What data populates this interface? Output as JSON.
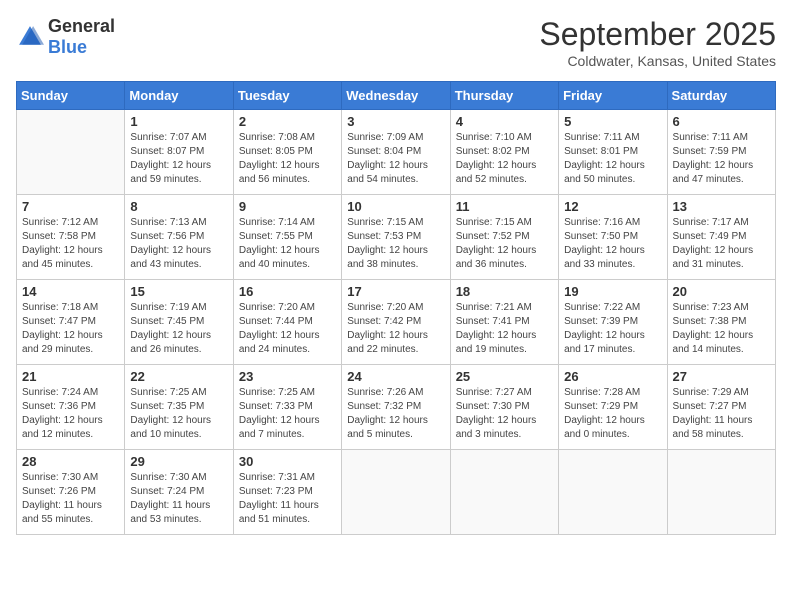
{
  "header": {
    "logo_general": "General",
    "logo_blue": "Blue",
    "month_title": "September 2025",
    "subtitle": "Coldwater, Kansas, United States"
  },
  "weekdays": [
    "Sunday",
    "Monday",
    "Tuesday",
    "Wednesday",
    "Thursday",
    "Friday",
    "Saturday"
  ],
  "weeks": [
    [
      {
        "day": "",
        "info": ""
      },
      {
        "day": "1",
        "info": "Sunrise: 7:07 AM\nSunset: 8:07 PM\nDaylight: 12 hours\nand 59 minutes."
      },
      {
        "day": "2",
        "info": "Sunrise: 7:08 AM\nSunset: 8:05 PM\nDaylight: 12 hours\nand 56 minutes."
      },
      {
        "day": "3",
        "info": "Sunrise: 7:09 AM\nSunset: 8:04 PM\nDaylight: 12 hours\nand 54 minutes."
      },
      {
        "day": "4",
        "info": "Sunrise: 7:10 AM\nSunset: 8:02 PM\nDaylight: 12 hours\nand 52 minutes."
      },
      {
        "day": "5",
        "info": "Sunrise: 7:11 AM\nSunset: 8:01 PM\nDaylight: 12 hours\nand 50 minutes."
      },
      {
        "day": "6",
        "info": "Sunrise: 7:11 AM\nSunset: 7:59 PM\nDaylight: 12 hours\nand 47 minutes."
      }
    ],
    [
      {
        "day": "7",
        "info": "Sunrise: 7:12 AM\nSunset: 7:58 PM\nDaylight: 12 hours\nand 45 minutes."
      },
      {
        "day": "8",
        "info": "Sunrise: 7:13 AM\nSunset: 7:56 PM\nDaylight: 12 hours\nand 43 minutes."
      },
      {
        "day": "9",
        "info": "Sunrise: 7:14 AM\nSunset: 7:55 PM\nDaylight: 12 hours\nand 40 minutes."
      },
      {
        "day": "10",
        "info": "Sunrise: 7:15 AM\nSunset: 7:53 PM\nDaylight: 12 hours\nand 38 minutes."
      },
      {
        "day": "11",
        "info": "Sunrise: 7:15 AM\nSunset: 7:52 PM\nDaylight: 12 hours\nand 36 minutes."
      },
      {
        "day": "12",
        "info": "Sunrise: 7:16 AM\nSunset: 7:50 PM\nDaylight: 12 hours\nand 33 minutes."
      },
      {
        "day": "13",
        "info": "Sunrise: 7:17 AM\nSunset: 7:49 PM\nDaylight: 12 hours\nand 31 minutes."
      }
    ],
    [
      {
        "day": "14",
        "info": "Sunrise: 7:18 AM\nSunset: 7:47 PM\nDaylight: 12 hours\nand 29 minutes."
      },
      {
        "day": "15",
        "info": "Sunrise: 7:19 AM\nSunset: 7:45 PM\nDaylight: 12 hours\nand 26 minutes."
      },
      {
        "day": "16",
        "info": "Sunrise: 7:20 AM\nSunset: 7:44 PM\nDaylight: 12 hours\nand 24 minutes."
      },
      {
        "day": "17",
        "info": "Sunrise: 7:20 AM\nSunset: 7:42 PM\nDaylight: 12 hours\nand 22 minutes."
      },
      {
        "day": "18",
        "info": "Sunrise: 7:21 AM\nSunset: 7:41 PM\nDaylight: 12 hours\nand 19 minutes."
      },
      {
        "day": "19",
        "info": "Sunrise: 7:22 AM\nSunset: 7:39 PM\nDaylight: 12 hours\nand 17 minutes."
      },
      {
        "day": "20",
        "info": "Sunrise: 7:23 AM\nSunset: 7:38 PM\nDaylight: 12 hours\nand 14 minutes."
      }
    ],
    [
      {
        "day": "21",
        "info": "Sunrise: 7:24 AM\nSunset: 7:36 PM\nDaylight: 12 hours\nand 12 minutes."
      },
      {
        "day": "22",
        "info": "Sunrise: 7:25 AM\nSunset: 7:35 PM\nDaylight: 12 hours\nand 10 minutes."
      },
      {
        "day": "23",
        "info": "Sunrise: 7:25 AM\nSunset: 7:33 PM\nDaylight: 12 hours\nand 7 minutes."
      },
      {
        "day": "24",
        "info": "Sunrise: 7:26 AM\nSunset: 7:32 PM\nDaylight: 12 hours\nand 5 minutes."
      },
      {
        "day": "25",
        "info": "Sunrise: 7:27 AM\nSunset: 7:30 PM\nDaylight: 12 hours\nand 3 minutes."
      },
      {
        "day": "26",
        "info": "Sunrise: 7:28 AM\nSunset: 7:29 PM\nDaylight: 12 hours\nand 0 minutes."
      },
      {
        "day": "27",
        "info": "Sunrise: 7:29 AM\nSunset: 7:27 PM\nDaylight: 11 hours\nand 58 minutes."
      }
    ],
    [
      {
        "day": "28",
        "info": "Sunrise: 7:30 AM\nSunset: 7:26 PM\nDaylight: 11 hours\nand 55 minutes."
      },
      {
        "day": "29",
        "info": "Sunrise: 7:30 AM\nSunset: 7:24 PM\nDaylight: 11 hours\nand 53 minutes."
      },
      {
        "day": "30",
        "info": "Sunrise: 7:31 AM\nSunset: 7:23 PM\nDaylight: 11 hours\nand 51 minutes."
      },
      {
        "day": "",
        "info": ""
      },
      {
        "day": "",
        "info": ""
      },
      {
        "day": "",
        "info": ""
      },
      {
        "day": "",
        "info": ""
      }
    ]
  ]
}
